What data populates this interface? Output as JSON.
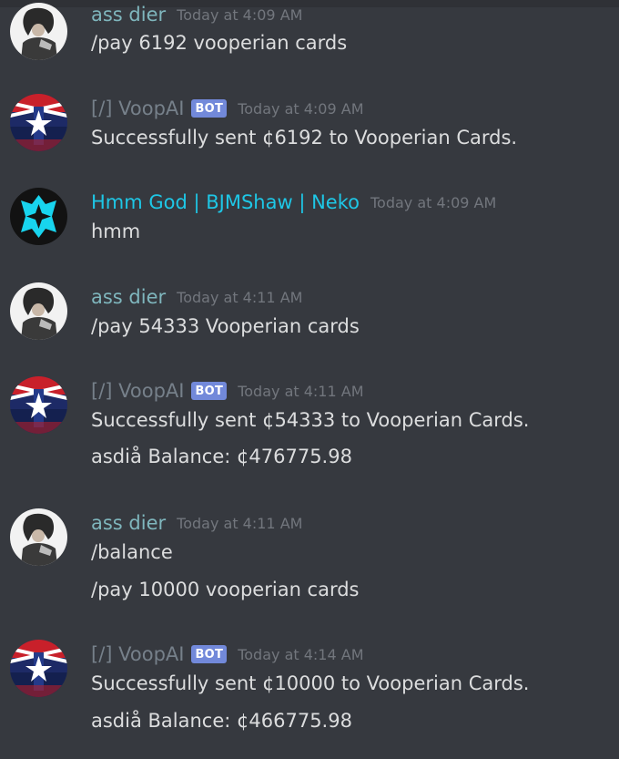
{
  "messages": [
    {
      "author": "ass dier",
      "time": "Today at 4:09 AM",
      "lines": [
        "/pay 6192 vooperian cards"
      ]
    },
    {
      "author": "[/] VoopAI",
      "bot_tag": "BOT",
      "time": "Today at 4:09 AM",
      "lines": [
        "Successfully sent ¢6192 to Vooperian Cards."
      ]
    },
    {
      "author": "Hmm God | BJMShaw | Neko",
      "time": "Today at 4:09 AM",
      "lines": [
        "hmm"
      ]
    },
    {
      "author": "ass dier",
      "time": "Today at 4:11 AM",
      "lines": [
        "/pay 54333 Vooperian cards"
      ]
    },
    {
      "author": "[/] VoopAI",
      "bot_tag": "BOT",
      "time": "Today at 4:11 AM",
      "lines": [
        "Successfully sent ¢54333 to Vooperian Cards.",
        "asdiå Balance: ¢476775.98"
      ]
    },
    {
      "author": "ass dier",
      "time": "Today at 4:11 AM",
      "lines": [
        "/balance",
        "/pay 10000 vooperian cards"
      ]
    },
    {
      "author": "[/] VoopAI",
      "bot_tag": "BOT",
      "time": "Today at 4:14 AM",
      "lines": [
        "Successfully sent ¢10000 to Vooperian Cards.",
        "asdiå Balance: ¢466775.98"
      ]
    }
  ],
  "colors": {
    "background": "#36393f",
    "user_name": "#7fb6bd",
    "bot_name": "#76808a",
    "neko_name": "#1ec7e6",
    "bot_tag": "#7289da",
    "timestamp": "#72767d"
  }
}
